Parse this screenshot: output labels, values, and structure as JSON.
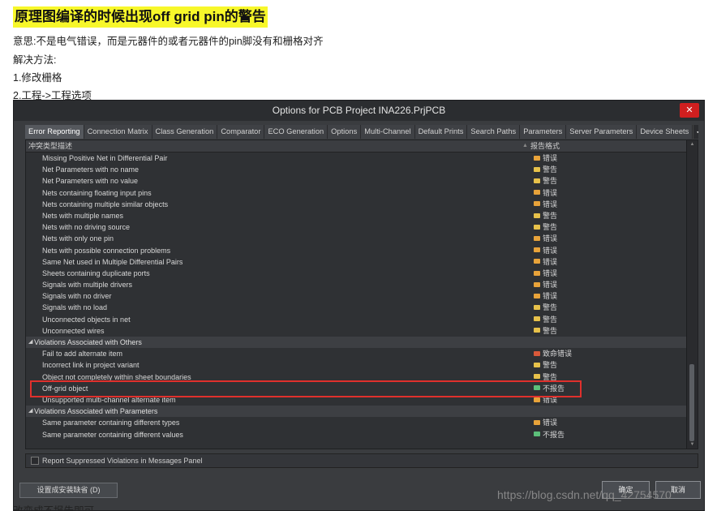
{
  "doc": {
    "title": "原理图编译的时候出现off grid pin的警告",
    "lines": [
      "意思:不是电气错误，而是元器件的或者元器件的pin脚没有和栅格对齐",
      "解决方法:",
      "1.修改栅格",
      "2.工程->工程选项"
    ],
    "cut_line": "改变成不报告即可"
  },
  "dialog": {
    "title": "Options for PCB Project INA226.PrjPCB",
    "close_label": "✕",
    "tabs": [
      {
        "label": "Error Reporting",
        "active": true
      },
      {
        "label": "Connection Matrix",
        "active": false
      },
      {
        "label": "Class Generation",
        "active": false
      },
      {
        "label": "Comparator",
        "active": false
      },
      {
        "label": "ECO Generation",
        "active": false
      },
      {
        "label": "Options",
        "active": false
      },
      {
        "label": "Multi-Channel",
        "active": false
      },
      {
        "label": "Default Prints",
        "active": false
      },
      {
        "label": "Search Paths",
        "active": false
      },
      {
        "label": "Parameters",
        "active": false
      },
      {
        "label": "Server Parameters",
        "active": false
      },
      {
        "label": "Device Sheets",
        "active": false
      }
    ],
    "tab_scroll": {
      "left": "◀",
      "right": "▶"
    },
    "columns": {
      "type": "冲突类型描述",
      "report": "报告格式",
      "sort_indicator": "▲"
    },
    "level_colors": {
      "错误": "#e8a33a",
      "警告": "#e7c14a",
      "致命错误": "#d9593a",
      "不报告": "#5cbf7a"
    },
    "rows": [
      {
        "kind": "item",
        "label": "Missing Positive Net in Differential Pair",
        "value": "错误"
      },
      {
        "kind": "item",
        "label": "Net Parameters with no name",
        "value": "警告"
      },
      {
        "kind": "item",
        "label": "Net Parameters with no value",
        "value": "警告"
      },
      {
        "kind": "item",
        "label": "Nets containing floating input pins",
        "value": "错误"
      },
      {
        "kind": "item",
        "label": "Nets containing multiple similar objects",
        "value": "错误"
      },
      {
        "kind": "item",
        "label": "Nets with multiple names",
        "value": "警告"
      },
      {
        "kind": "item",
        "label": "Nets with no driving source",
        "value": "警告"
      },
      {
        "kind": "item",
        "label": "Nets with only one pin",
        "value": "错误"
      },
      {
        "kind": "item",
        "label": "Nets with possible connection problems",
        "value": "错误"
      },
      {
        "kind": "item",
        "label": "Same Net used in Multiple Differential Pairs",
        "value": "错误"
      },
      {
        "kind": "item",
        "label": "Sheets containing duplicate ports",
        "value": "错误"
      },
      {
        "kind": "item",
        "label": "Signals with multiple drivers",
        "value": "错误"
      },
      {
        "kind": "item",
        "label": "Signals with no driver",
        "value": "错误"
      },
      {
        "kind": "item",
        "label": "Signals with no load",
        "value": "警告"
      },
      {
        "kind": "item",
        "label": "Unconnected objects in net",
        "value": "警告"
      },
      {
        "kind": "item",
        "label": "Unconnected wires",
        "value": "警告"
      },
      {
        "kind": "group",
        "label": "Violations Associated with Others",
        "expander": "◢"
      },
      {
        "kind": "item",
        "label": "Fail to add alternate item",
        "value": "致命错误"
      },
      {
        "kind": "item",
        "label": "Incorrect link in project variant",
        "value": "警告"
      },
      {
        "kind": "item",
        "label": "Object not completely within sheet boundaries",
        "value": "警告"
      },
      {
        "kind": "item",
        "label": "Off-grid object",
        "value": "不报告"
      },
      {
        "kind": "item",
        "label": "Unsupported multi-channel alternate item",
        "value": "错误"
      },
      {
        "kind": "group",
        "label": "Violations Associated with Parameters",
        "expander": "◢"
      },
      {
        "kind": "item",
        "label": "Same parameter containing different types",
        "value": "错误"
      },
      {
        "kind": "item",
        "label": "Same parameter containing different values",
        "value": "不报告"
      }
    ],
    "report_suppressed_label": "Report Suppressed Violations in Messages Panel",
    "defaults_button": "设置成安装缺省 (D)",
    "ok_button": "确定",
    "cancel_button": "取消"
  },
  "watermark": "https://blog.csdn.net/qq_42754570"
}
